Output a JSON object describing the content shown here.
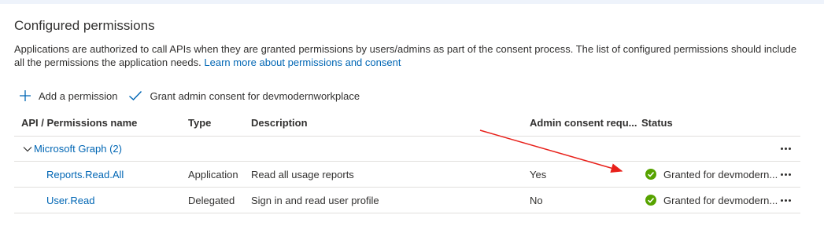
{
  "section": {
    "title": "Configured permissions",
    "description": "Applications are authorized to call APIs when they are granted permissions by users/admins as part of the consent process. The list of configured permissions should include all the permissions the application needs.",
    "learn_more": "Learn more about permissions and consent"
  },
  "toolbar": {
    "add_label": "Add a permission",
    "grant_label": "Grant admin consent for devmodernworkplace"
  },
  "table": {
    "headers": {
      "api": "API / Permissions name",
      "type": "Type",
      "description": "Description",
      "admin": "Admin consent requ...",
      "status": "Status"
    },
    "group": {
      "label": "Microsoft Graph (2)"
    },
    "rows": [
      {
        "name": "Reports.Read.All",
        "type": "Application",
        "description": "Read all usage reports",
        "admin": "Yes",
        "status": "Granted for devmodern..."
      },
      {
        "name": "User.Read",
        "type": "Delegated",
        "description": "Sign in and read user profile",
        "admin": "No",
        "status": "Granted for devmodern..."
      }
    ]
  },
  "colors": {
    "accent": "#0066b4",
    "success": "#57a300",
    "annotation": "#e8201a"
  },
  "icons": {
    "add": "plus-icon",
    "grant": "checkmark-icon",
    "group_toggle": "chevron-down-icon",
    "status": "success-check-icon",
    "more": "more-ellipsis-icon"
  }
}
